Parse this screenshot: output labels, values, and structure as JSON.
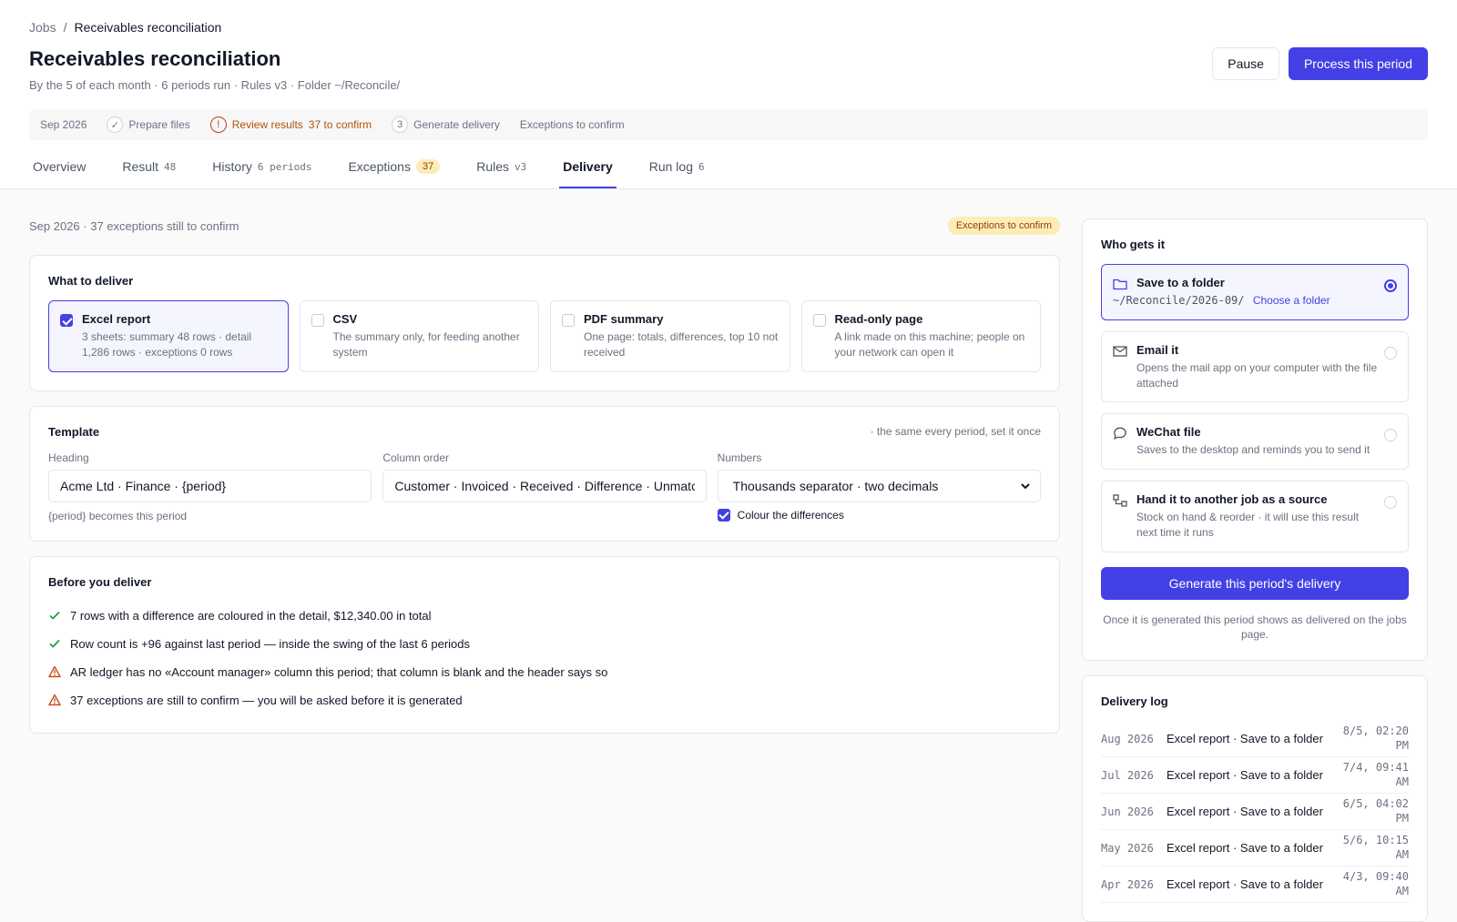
{
  "breadcrumb": {
    "root": "Jobs",
    "sep": "/",
    "current": "Receivables reconciliation"
  },
  "page": {
    "title": "Receivables reconciliation",
    "subtitle": "By the 5 of each month · 6 periods run · Rules v3 · Folder ~/Reconcile/"
  },
  "actions": {
    "pause": "Pause",
    "process": "Process this period"
  },
  "stepper": {
    "period": "Sep 2026",
    "steps": [
      {
        "icon": "check-icon",
        "glyph": "✓",
        "label": "Prepare files",
        "extra": ""
      },
      {
        "icon": "alert-circle-icon",
        "glyph": "!",
        "label": "Review results",
        "extra": "37 to confirm"
      },
      {
        "icon": "step-number-icon",
        "glyph": "3",
        "label": "Generate delivery",
        "extra": ""
      }
    ],
    "status": "Exceptions to confirm"
  },
  "tabs": [
    {
      "label": "Overview",
      "count": ""
    },
    {
      "label": "Result",
      "count": "48"
    },
    {
      "label": "History",
      "count": "6 periods"
    },
    {
      "label": "Exceptions",
      "count": "37"
    },
    {
      "label": "Rules",
      "count": "v3"
    },
    {
      "label": "Delivery",
      "count": ""
    },
    {
      "label": "Run log",
      "count": "6"
    }
  ],
  "period_line": {
    "text": "Sep 2026 · 37 exceptions still to confirm",
    "badge": "Exceptions to confirm"
  },
  "what_to_deliver": {
    "title": "What to deliver",
    "formats": [
      {
        "name": "Excel report",
        "desc": "3 sheets: summary 48 rows · detail 1,286 rows · exceptions 0 rows",
        "selected": true
      },
      {
        "name": "CSV",
        "desc": "The summary only, for feeding another system",
        "selected": false
      },
      {
        "name": "PDF summary",
        "desc": "One page: totals, differences, top 10 not received",
        "selected": false
      },
      {
        "name": "Read-only page",
        "desc": "A link made on this machine; people on your network can open it",
        "selected": false
      }
    ]
  },
  "template": {
    "title": "Template",
    "note": "· the same every period, set it once",
    "heading_label": "Heading",
    "heading_value": "Acme Ltd · Finance · {period}",
    "heading_help": "{period} becomes this period",
    "column_label": "Column order",
    "column_value": "Customer · Invoiced · Received · Difference · Unmatched",
    "numbers_label": "Numbers",
    "numbers_value": "Thousands separator · two decimals",
    "colour_label": "Colour the differences"
  },
  "before": {
    "title": "Before you deliver",
    "items": [
      {
        "kind": "ok",
        "text": "7 rows with a difference are coloured in the detail, $12,340.00 in total"
      },
      {
        "kind": "ok",
        "text": "Row count is +96 against last period — inside the swing of the last 6 periods"
      },
      {
        "kind": "warn",
        "text": "AR ledger has no «Account manager» column this period; that column is blank and the header says so"
      },
      {
        "kind": "warn",
        "text": "37 exceptions are still to confirm — you will be asked before it is generated"
      }
    ]
  },
  "who": {
    "title": "Who gets it",
    "folder": {
      "name": "Save to a folder",
      "path": "~/Reconcile/2026-09/",
      "link": "Choose a folder"
    },
    "email": {
      "name": "Email it",
      "desc": "Opens the mail app on your computer with the file attached"
    },
    "wechat": {
      "name": "WeChat file",
      "desc": "Saves to the desktop and reminds you to send it"
    },
    "handoff": {
      "name": "Hand it to another job as a source",
      "desc": "Stock on hand & reorder · it will use this result next time it runs"
    },
    "generate": "Generate this period's delivery",
    "note": "Once it is generated this period shows as delivered on the jobs page."
  },
  "delivery_log": {
    "title": "Delivery log",
    "rows": [
      {
        "period": "Aug 2026",
        "what": "Excel report · Save to a folder",
        "date": "8/5, 02:20",
        "ampm": "PM"
      },
      {
        "period": "Jul 2026",
        "what": "Excel report · Save to a folder",
        "date": "7/4, 09:41",
        "ampm": "AM"
      },
      {
        "period": "Jun 2026",
        "what": "Excel report · Save to a folder",
        "date": "6/5, 04:02",
        "ampm": "PM"
      },
      {
        "period": "May 2026",
        "what": "Excel report · Save to a folder",
        "date": "5/6, 10:15",
        "ampm": "AM"
      },
      {
        "period": "Apr 2026",
        "what": "Excel report · Save to a folder",
        "date": "4/3, 09:40",
        "ampm": "AM"
      }
    ]
  },
  "colors": {
    "accent": "#4340e6",
    "warn": "#c2410c",
    "ok": "#16a34a",
    "badge_bg": "#fdecb5"
  }
}
